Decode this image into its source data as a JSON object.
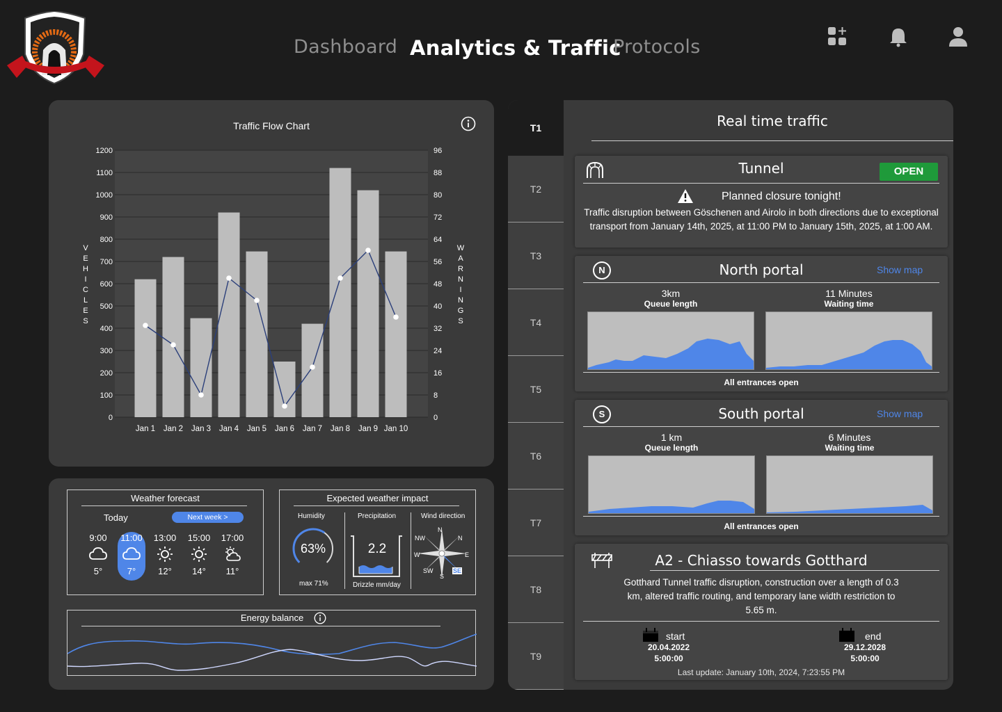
{
  "nav": {
    "dashboard": "Dashboard",
    "analytics": "Analytics & Traffic",
    "protocols": "Protocols"
  },
  "header_icons": [
    "apps-add-icon",
    "bell-icon",
    "user-icon"
  ],
  "colors": {
    "accent": "#4f86e8",
    "open": "#1f9a3a",
    "panel": "#3a3a3a",
    "bg": "#1c1c1c"
  },
  "traffic_chart": {
    "title": "Traffic Flow Chart",
    "left_axis_label": "VEHICLES",
    "right_axis_label": "WARNINGS"
  },
  "chart_data": {
    "type": "bar",
    "title": "Traffic Flow Chart",
    "categories": [
      "Jan 1",
      "Jan 2",
      "Jan 3",
      "Jan 4",
      "Jan 5",
      "Jan 6",
      "Jan 7",
      "Jan 8",
      "Jan 9",
      "Jan 10"
    ],
    "series": [
      {
        "name": "VEHICLES",
        "type": "bar",
        "values": [
          620,
          720,
          445,
          920,
          745,
          250,
          420,
          1120,
          1020,
          745
        ]
      },
      {
        "name": "WARNINGS",
        "type": "line",
        "axis": "right",
        "values": [
          33,
          26,
          8,
          50,
          42,
          4,
          18,
          50,
          60,
          36
        ]
      }
    ],
    "ylabel": "VEHICLES",
    "ylim": [
      0,
      1200
    ],
    "yticks": [
      0,
      100,
      200,
      300,
      400,
      500,
      600,
      700,
      800,
      900,
      1000,
      1100,
      1200
    ],
    "y2label": "WARNINGS",
    "y2lim": [
      0,
      96
    ],
    "y2ticks": [
      0,
      8,
      16,
      24,
      32,
      40,
      48,
      56,
      64,
      72,
      80,
      88,
      96
    ],
    "grid": true
  },
  "weather": {
    "title": "Weather forecast",
    "today": "Today",
    "next_week": "Next week >",
    "hours": [
      {
        "time": "9:00",
        "icon": "cloud-icon",
        "temp": "5°"
      },
      {
        "time": "11:00",
        "icon": "cloud-icon",
        "temp": "7°",
        "selected": true
      },
      {
        "time": "13:00",
        "icon": "sun-icon",
        "temp": "12°"
      },
      {
        "time": "15:00",
        "icon": "sun-icon",
        "temp": "14°"
      },
      {
        "time": "17:00",
        "icon": "partly-cloudy-icon",
        "temp": "11°"
      }
    ]
  },
  "impact": {
    "title": "Expected weather impact",
    "humidity_label": "Humidity",
    "humidity_value": "63%",
    "humidity_level": 0.63,
    "humidity_max": "max 71%",
    "precip_label": "Precipitation",
    "precip_value": "2.2",
    "precip_caption": "Drizzle mm/day",
    "wind_label": "Wind direction",
    "compass": {
      "n": "N",
      "ne": "N",
      "nw": "NW",
      "w": "W",
      "e": "E",
      "sw": "SW",
      "s": "S",
      "se": "SE"
    }
  },
  "energy": {
    "title": "Energy balance"
  },
  "traffic": {
    "title": "Real time traffic",
    "tabs": [
      "T1",
      "T2",
      "T3",
      "T4",
      "T5",
      "T6",
      "T7",
      "T8",
      "T9"
    ],
    "tunnel": {
      "title": "Tunnel",
      "status": "OPEN",
      "alert_title": "Planned closure tonight!",
      "alert_text": "Traffic disruption between Göschenen and Airolo in both directions due to exceptional transport from January 14th, 2025, at 11:00 PM to January 15th, 2025, at 1:00 AM."
    },
    "north": {
      "badge": "N",
      "title": "North portal",
      "show_map": "Show map",
      "queue_value": "3km",
      "queue_label": "Queue length",
      "wait_value": "11 Minutes",
      "wait_label": "Waiting time",
      "note": "All entrances open"
    },
    "south": {
      "badge": "S",
      "title": "South portal",
      "show_map": "Show map",
      "queue_value": "1 km",
      "queue_label": "Queue length",
      "wait_value": "6 Minutes",
      "wait_label": "Waiting time",
      "note": "All entrances open"
    },
    "road": {
      "title": "A2 - Chiasso towards Gotthard",
      "text": "Gotthard Tunnel traffic disruption, construction over a length of 0.3 km, altered traffic routing, and temporary lane width restriction to 5.65 m.",
      "start_label": "start",
      "start_date": "20.04.2022",
      "start_time": "5:00:00",
      "end_label": "end",
      "end_date": "29.12.2028",
      "end_time": "5:00:00",
      "last_update": "Last update: January 10th, 2024, 7:23:55 PM"
    }
  }
}
